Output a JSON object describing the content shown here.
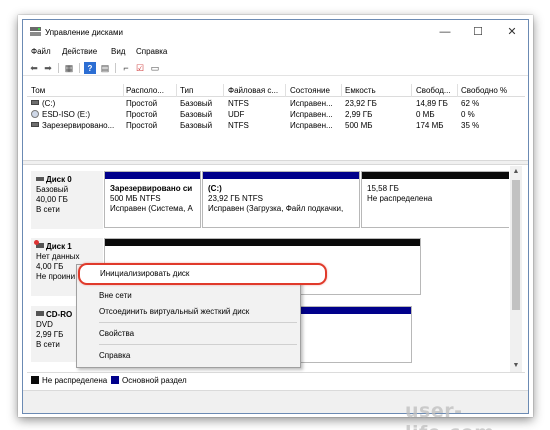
{
  "window": {
    "title": "Управление дисками",
    "controls": {
      "minimize": "—",
      "maximize": "☐",
      "close": "✕"
    }
  },
  "menu": {
    "items": [
      {
        "label": "Файл"
      },
      {
        "label": "Действие"
      },
      {
        "label": "Вид"
      },
      {
        "label": "Справка"
      }
    ]
  },
  "toolbar": {
    "icons": [
      "back-arrow-icon",
      "forward-arrow-icon",
      "grid-view-icon",
      "help-icon",
      "properties-icon",
      "connect-icon",
      "check-icon",
      "details-icon"
    ]
  },
  "volumes": {
    "headers": [
      "Том",
      "Располо...",
      "Тип",
      "Файловая с...",
      "Состояние",
      "Емкость",
      "Свобод...",
      "Свободно %"
    ],
    "rows": [
      {
        "name": "(C:)",
        "layout": "Простой",
        "type": "Базовый",
        "fs": "NTFS",
        "status": "Исправен...",
        "capacity": "23,92 ГБ",
        "free": "14,89 ГБ",
        "free_pct": "62 %",
        "icon": "drive-icon"
      },
      {
        "name": "ESD-ISO (E:)",
        "layout": "Простой",
        "type": "Базовый",
        "fs": "UDF",
        "status": "Исправен...",
        "capacity": "2,99 ГБ",
        "free": "0 МБ",
        "free_pct": "0 %",
        "icon": "disc-icon"
      },
      {
        "name": "Зарезервировано...",
        "layout": "Простой",
        "type": "Базовый",
        "fs": "NTFS",
        "status": "Исправен...",
        "capacity": "500 МБ",
        "free": "174 МБ",
        "free_pct": "35 %",
        "icon": "drive-icon"
      }
    ]
  },
  "disks": {
    "disk0": {
      "name": "Диск 0",
      "type": "Базовый",
      "size": "40,00 ГБ",
      "state": "В сети",
      "partitions": [
        {
          "title": "Зарезервировано си",
          "line2": "500 МБ NTFS",
          "line3": "Исправен (Система, А"
        },
        {
          "title": "(C:)",
          "line2": "23,92 ГБ NTFS",
          "line3": "Исправен (Загрузка, Файл подкачки,"
        },
        {
          "title": "",
          "line2": "15,58 ГБ",
          "line3": "Не распределена"
        }
      ]
    },
    "disk1": {
      "name": "Диск 1",
      "type": "Нет данных",
      "size": "4,00 ГБ",
      "state": "Не проини"
    },
    "cdrom": {
      "name": "CD-RO",
      "type": "DVD",
      "size": "2,99 ГБ",
      "state": "В сети"
    }
  },
  "context_menu": {
    "items": [
      "Инициализировать диск",
      "Вне сети",
      "Отсоединить виртуальный жесткий диск",
      "Свойства",
      "Справка"
    ]
  },
  "legend": {
    "unallocated": "Не распределена",
    "primary": "Основной раздел",
    "unallocated_color": "#0a0a0a",
    "primary_color": "#00008b"
  },
  "watermark": "user-life.com",
  "colors": {
    "highlight": "#e03a2b",
    "primary_partition": "#00008b"
  }
}
